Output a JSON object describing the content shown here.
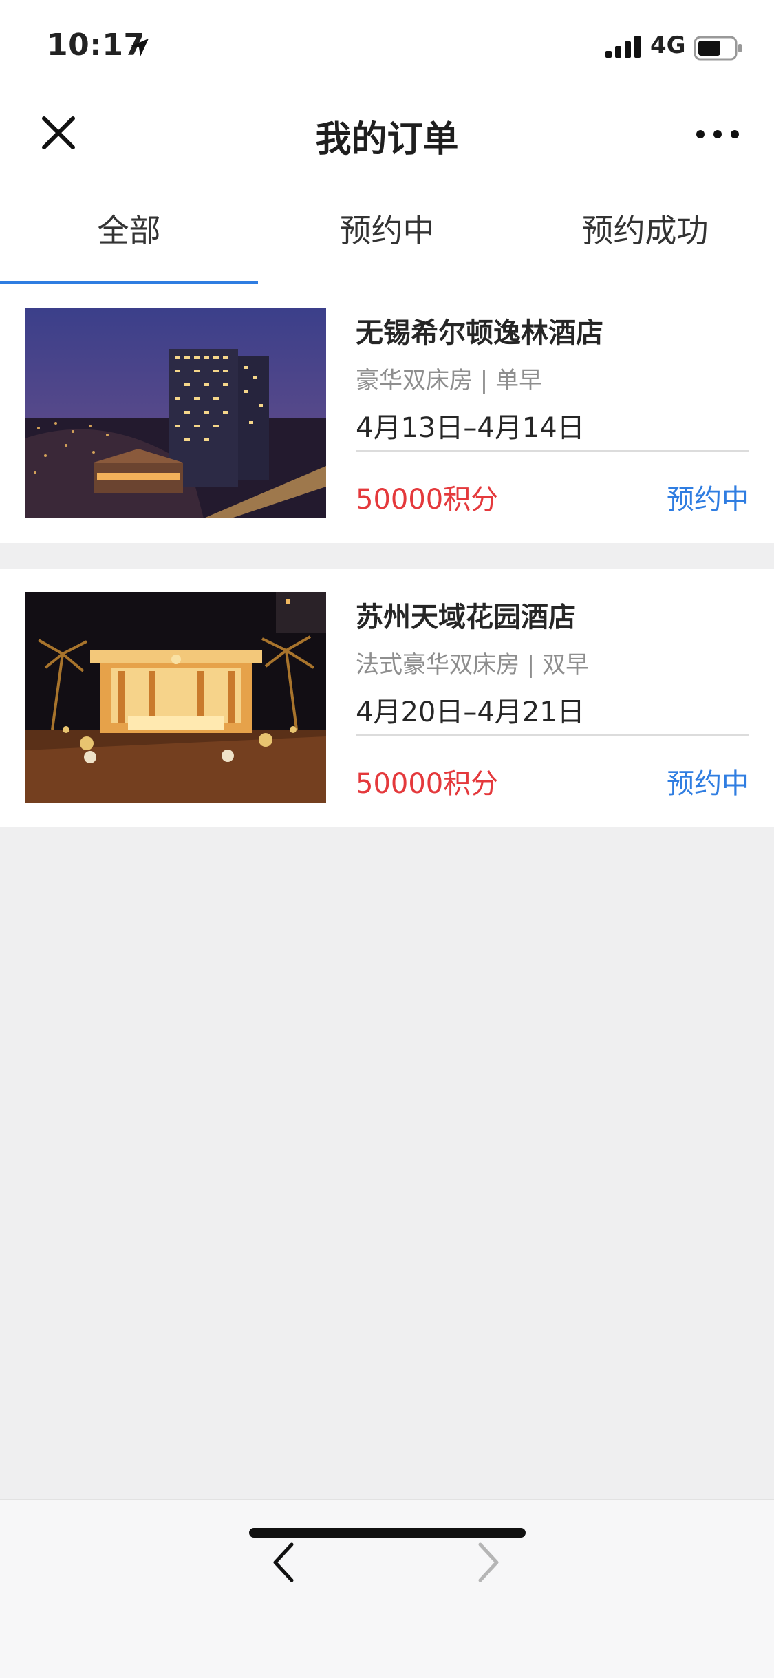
{
  "status_bar": {
    "time": "10:17",
    "network": "4G"
  },
  "header": {
    "title": "我的订单"
  },
  "tabs": [
    {
      "label": "全部",
      "active": true
    },
    {
      "label": "预约中",
      "active": false
    },
    {
      "label": "预约成功",
      "active": false
    }
  ],
  "orders": [
    {
      "hotel": "无锡希尔顿逸林酒店",
      "room": "豪华双床房 | 单早",
      "dates": "4月13日–4月14日",
      "points": "50000积分",
      "status": "预约中"
    },
    {
      "hotel": "苏州天域花园酒店",
      "room": "法式豪华双床房 | 双早",
      "dates": "4月20日–4月21日",
      "points": "50000积分",
      "status": "预约中"
    }
  ],
  "colors": {
    "accent": "#2f7de1",
    "points": "#e4393c",
    "background": "#efeff0"
  }
}
